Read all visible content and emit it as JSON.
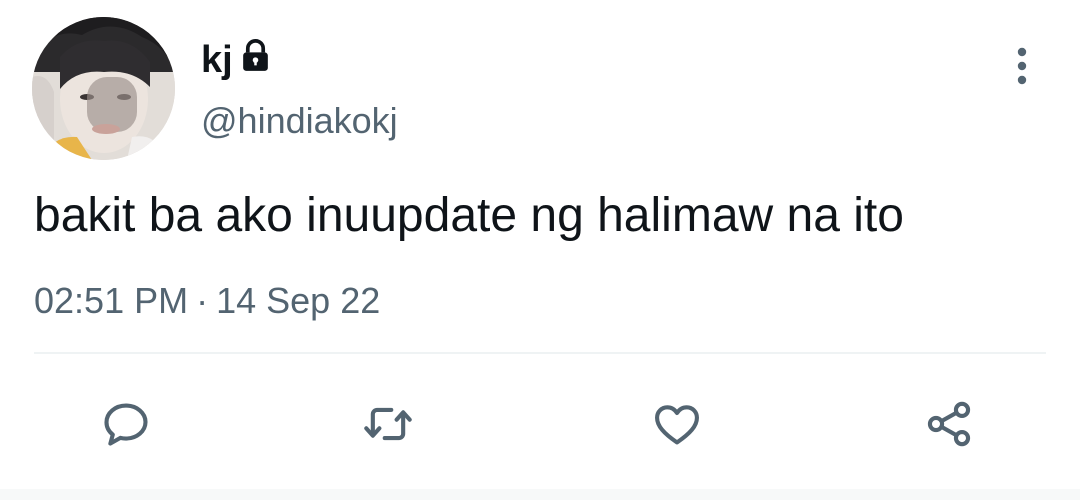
{
  "tweet": {
    "display_name": "kj",
    "handle": "@hindiakokj",
    "text": "bakit ba ako inuupdate ng halimaw na ito",
    "time": "02:51 PM",
    "separator": "·",
    "date": "14 Sep 22",
    "account_locked": true
  },
  "icons": {
    "lock": "lock-icon",
    "more": "more-vertical-icon",
    "reply": "reply-icon",
    "retweet": "retweet-icon",
    "like": "heart-icon",
    "share": "share-icon"
  },
  "colors": {
    "text_primary": "#0f1419",
    "text_secondary": "#536471",
    "divider": "#eff3f4"
  }
}
